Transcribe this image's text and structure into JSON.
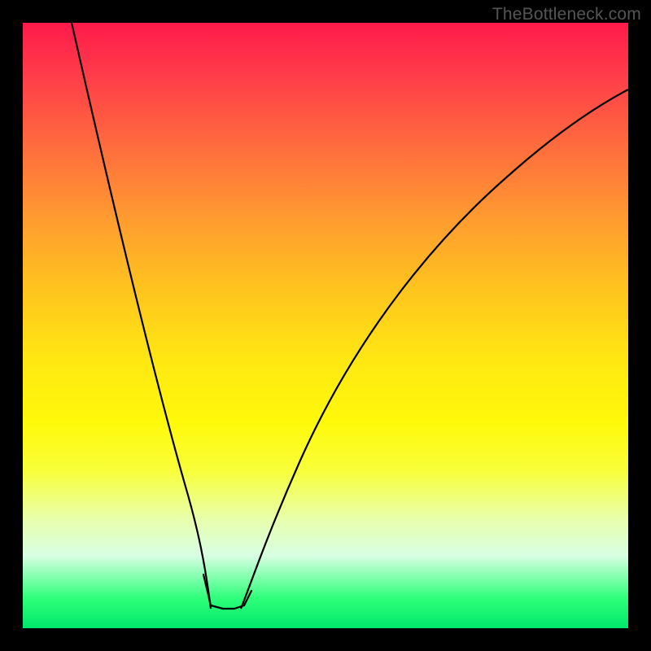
{
  "watermark": "TheBottleneck.com",
  "chart_data": {
    "type": "line",
    "title": "",
    "xlabel": "",
    "ylabel": "",
    "xlim": [
      0,
      100
    ],
    "ylim": [
      0,
      100
    ],
    "series": [
      {
        "name": "left-curve",
        "x": [
          8,
          12,
          16,
          20,
          24,
          26.5,
          28.5,
          30,
          31
        ],
        "y": [
          100,
          78,
          56,
          36,
          18,
          8,
          2.5,
          0.5,
          0
        ]
      },
      {
        "name": "right-curve",
        "x": [
          36,
          38,
          41,
          45,
          50,
          57,
          66,
          78,
          92,
          100
        ],
        "y": [
          0,
          2,
          7,
          15,
          27,
          42,
          57,
          72,
          84,
          89
        ]
      }
    ],
    "annotations": [
      {
        "name": "marker-segment",
        "type": "polyline",
        "x": [
          29.8,
          31,
          33,
          35,
          36.5,
          37.8
        ],
        "y": [
          6,
          0.5,
          0,
          0,
          0.5,
          3
        ],
        "color": "#e06a6a"
      }
    ],
    "background_gradient": {
      "top": "#ff1a4b",
      "mid": "#fff90a",
      "bottom": "#00e86a"
    }
  }
}
